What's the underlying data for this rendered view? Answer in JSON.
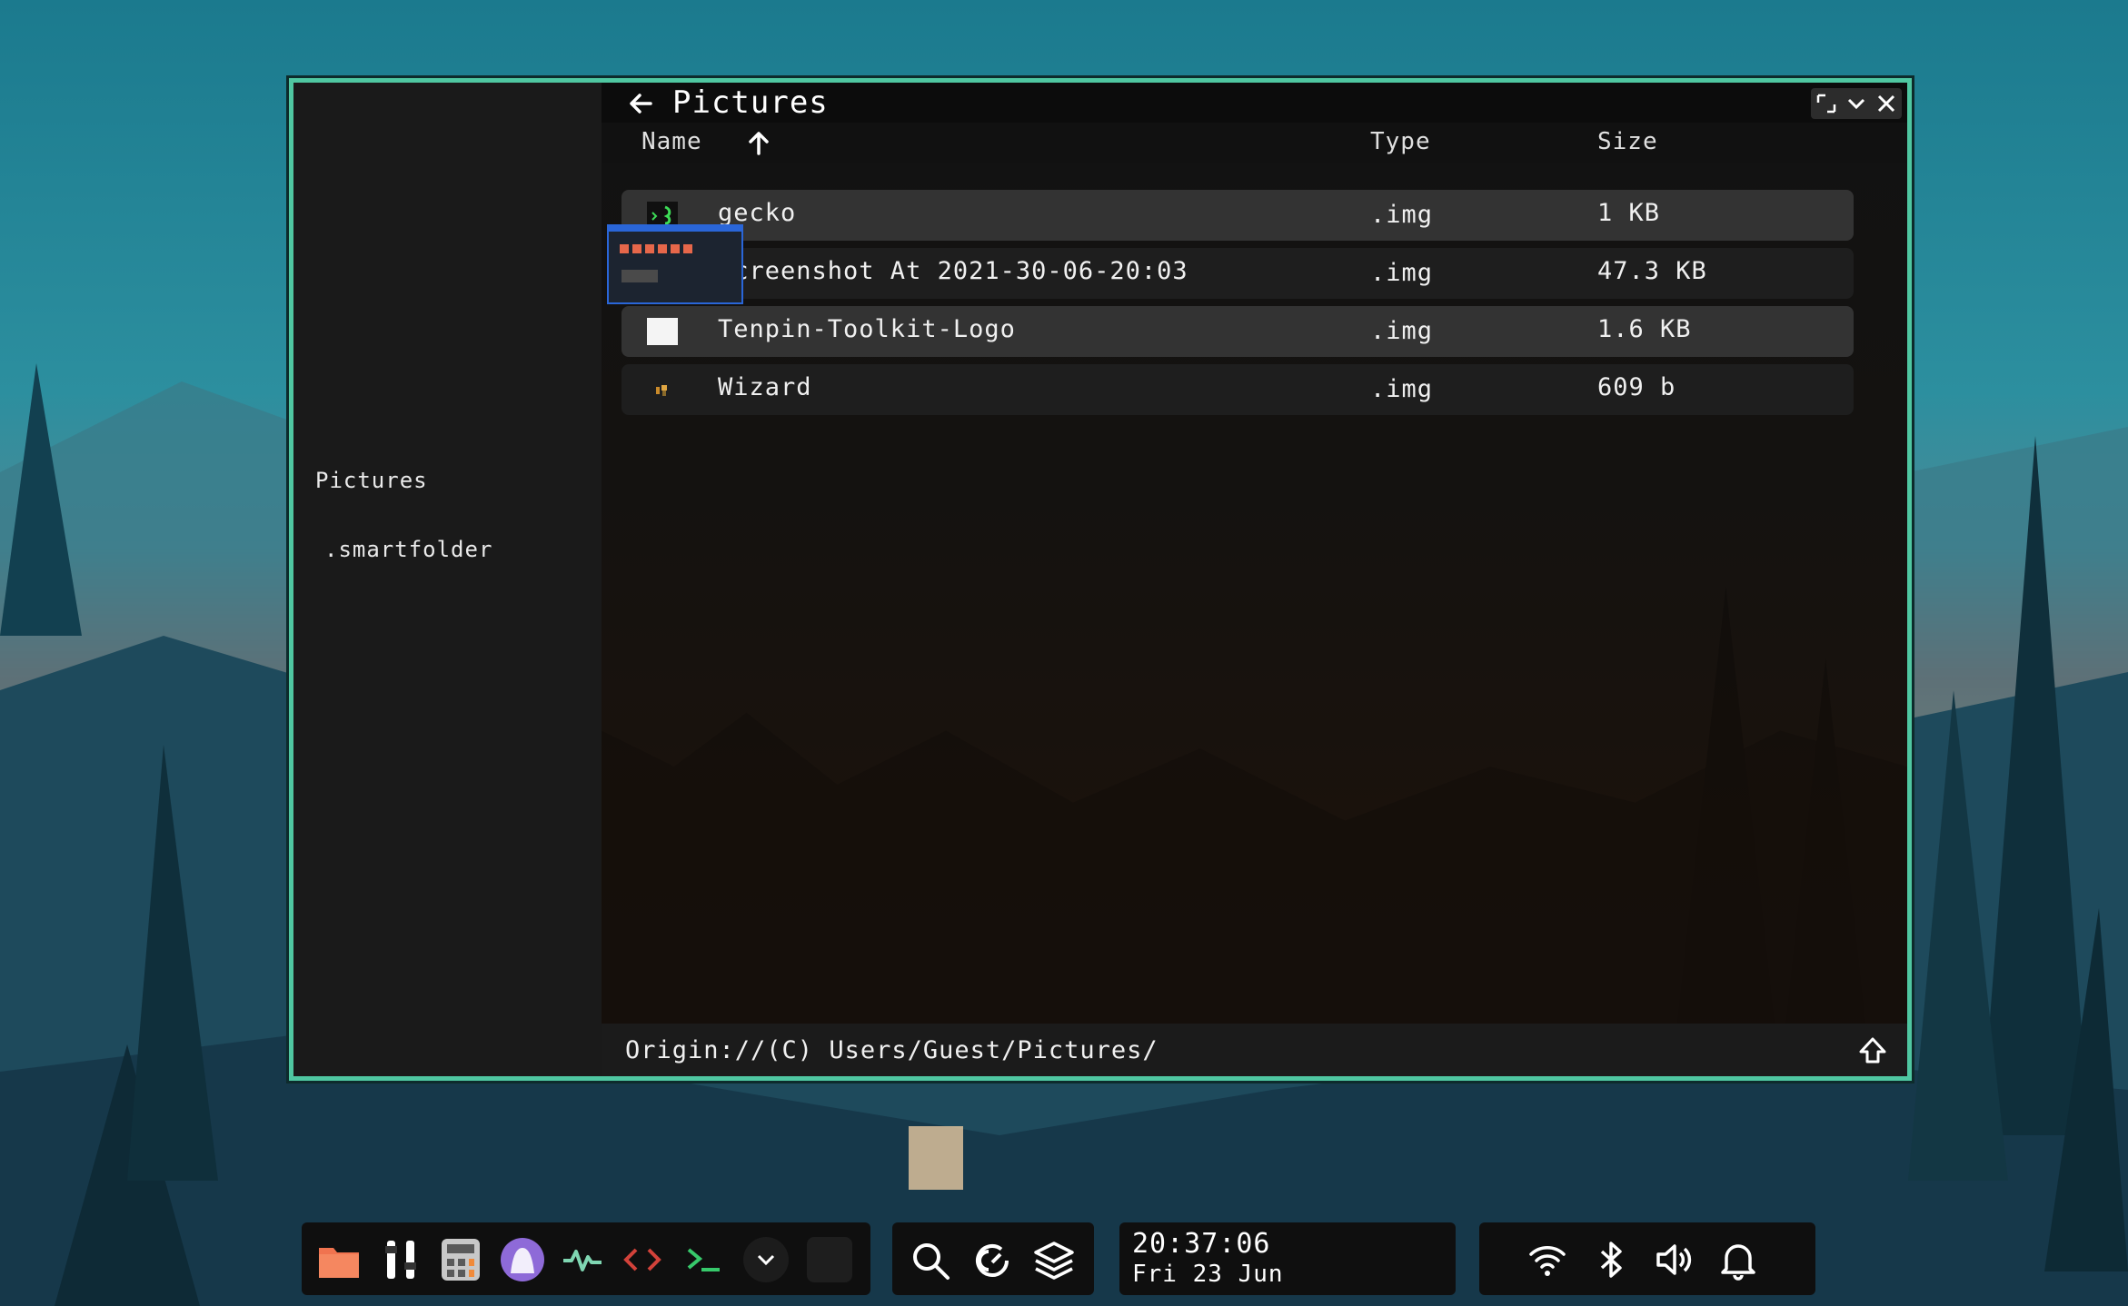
{
  "window": {
    "title": "Pictures",
    "columns": {
      "name": "Name",
      "type": "Type",
      "size": "Size"
    },
    "files": [
      {
        "name": "gecko",
        "type": ".img",
        "size": "1 KB"
      },
      {
        "name": "Screenshot At 2021-30-06-20:03",
        "type": ".img",
        "size": "47.3 KB"
      },
      {
        "name": "Tenpin-Toolkit-Logo",
        "type": ".img",
        "size": "1.6 KB"
      },
      {
        "name": "Wizard",
        "type": ".img",
        "size": "609 b"
      }
    ],
    "path": "Origin://(C) Users/Guest/Pictures/"
  },
  "sidebar": {
    "items": [
      {
        "label": "Pictures"
      },
      {
        "label": ".smartfolder"
      }
    ]
  },
  "taskbar": {
    "apps": [
      "files-icon",
      "tweaks-icon",
      "calculator-icon",
      "ghost-icon",
      "activity-monitor-icon",
      "code-editor-icon",
      "terminal-icon",
      "chevron-down-icon",
      "blank-app-icon"
    ],
    "tools": [
      "search-icon",
      "refresh-icon",
      "layers-icon"
    ],
    "clock": {
      "time": "20:37:06",
      "date": "Fri 23 Jun"
    },
    "status": [
      "wifi-icon",
      "bluetooth-icon",
      "volume-icon",
      "bell-icon"
    ]
  },
  "colors": {
    "accent": "#4fc7a1",
    "window_bg": "#161616",
    "row_highlight": "#333333"
  }
}
